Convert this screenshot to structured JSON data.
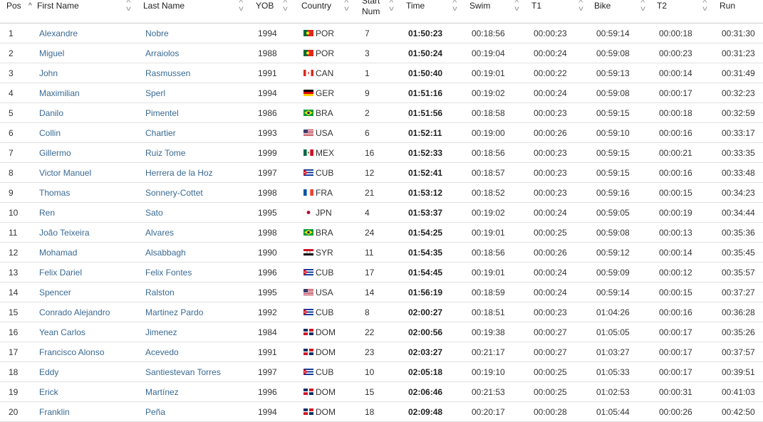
{
  "columns": {
    "pos": "Pos",
    "first_name": "First Name",
    "last_name": "Last Name",
    "yob": "YOB",
    "country": "Country",
    "start_num_1": "Start",
    "start_num_2": "Num",
    "time": "Time",
    "swim": "Swim",
    "t1": "T1",
    "bike": "Bike",
    "t2": "T2",
    "run": "Run"
  },
  "rows": [
    {
      "pos": "1",
      "first": "Alexandre",
      "last": "Nobre",
      "yob": "1994",
      "flag": "flag-portugal-icon",
      "country": "POR",
      "num": "7",
      "time": "01:50:23",
      "swim": "00:18:56",
      "t1": "00:00:23",
      "bike": "00:59:14",
      "t2": "00:00:18",
      "run": "00:31:30"
    },
    {
      "pos": "2",
      "first": "Miguel",
      "last": "Arraiolos",
      "yob": "1988",
      "flag": "flag-portugal-icon",
      "country": "POR",
      "num": "3",
      "time": "01:50:24",
      "swim": "00:19:04",
      "t1": "00:00:24",
      "bike": "00:59:08",
      "t2": "00:00:23",
      "run": "00:31:23"
    },
    {
      "pos": "3",
      "first": "John",
      "last": "Rasmussen",
      "yob": "1991",
      "flag": "flag-canada-icon",
      "country": "CAN",
      "num": "1",
      "time": "01:50:40",
      "swim": "00:19:01",
      "t1": "00:00:22",
      "bike": "00:59:13",
      "t2": "00:00:14",
      "run": "00:31:49"
    },
    {
      "pos": "4",
      "first": "Maximilian",
      "last": "Sperl",
      "yob": "1994",
      "flag": "flag-germany-icon",
      "country": "GER",
      "num": "9",
      "time": "01:51:16",
      "swim": "00:19:02",
      "t1": "00:00:24",
      "bike": "00:59:08",
      "t2": "00:00:17",
      "run": "00:32:23"
    },
    {
      "pos": "5",
      "first": "Danilo",
      "last": "Pimentel",
      "yob": "1986",
      "flag": "flag-brazil-icon",
      "country": "BRA",
      "num": "2",
      "time": "01:51:56",
      "swim": "00:18:58",
      "t1": "00:00:23",
      "bike": "00:59:15",
      "t2": "00:00:18",
      "run": "00:32:59"
    },
    {
      "pos": "6",
      "first": "Collin",
      "last": "Chartier",
      "yob": "1993",
      "flag": "flag-usa-icon",
      "country": "USA",
      "num": "6",
      "time": "01:52:11",
      "swim": "00:19:00",
      "t1": "00:00:26",
      "bike": "00:59:10",
      "t2": "00:00:16",
      "run": "00:33:17"
    },
    {
      "pos": "7",
      "first": "Gillermo",
      "last": "Ruiz Tome",
      "yob": "1999",
      "flag": "flag-mexico-icon",
      "country": "MEX",
      "num": "16",
      "time": "01:52:33",
      "swim": "00:18:56",
      "t1": "00:00:23",
      "bike": "00:59:15",
      "t2": "00:00:21",
      "run": "00:33:35"
    },
    {
      "pos": "8",
      "first": "Victor Manuel",
      "last": "Herrera de la Hoz",
      "yob": "1997",
      "flag": "flag-cuba-icon",
      "country": "CUB",
      "num": "12",
      "time": "01:52:41",
      "swim": "00:18:57",
      "t1": "00:00:23",
      "bike": "00:59:15",
      "t2": "00:00:16",
      "run": "00:33:48"
    },
    {
      "pos": "9",
      "first": "Thomas",
      "last": "Sonnery-Cottet",
      "yob": "1998",
      "flag": "flag-france-icon",
      "country": "FRA",
      "num": "21",
      "time": "01:53:12",
      "swim": "00:18:52",
      "t1": "00:00:23",
      "bike": "00:59:16",
      "t2": "00:00:15",
      "run": "00:34:23"
    },
    {
      "pos": "10",
      "first": "Ren",
      "last": "Sato",
      "yob": "1995",
      "flag": "flag-japan-icon",
      "country": "JPN",
      "num": "4",
      "time": "01:53:37",
      "swim": "00:19:02",
      "t1": "00:00:24",
      "bike": "00:59:05",
      "t2": "00:00:19",
      "run": "00:34:44"
    },
    {
      "pos": "11",
      "first": "João Teixeira",
      "last": "Alvares",
      "yob": "1998",
      "flag": "flag-brazil-icon",
      "country": "BRA",
      "num": "24",
      "time": "01:54:25",
      "swim": "00:19:01",
      "t1": "00:00:25",
      "bike": "00:59:08",
      "t2": "00:00:13",
      "run": "00:35:36"
    },
    {
      "pos": "12",
      "first": "Mohamad",
      "last": "Alsabbagh",
      "yob": "1990",
      "flag": "flag-syria-icon",
      "country": "SYR",
      "num": "11",
      "time": "01:54:35",
      "swim": "00:18:56",
      "t1": "00:00:26",
      "bike": "00:59:12",
      "t2": "00:00:14",
      "run": "00:35:45"
    },
    {
      "pos": "13",
      "first": "Felix Dariel",
      "last": "Felix Fontes",
      "yob": "1996",
      "flag": "flag-cuba-icon",
      "country": "CUB",
      "num": "17",
      "time": "01:54:45",
      "swim": "00:19:01",
      "t1": "00:00:24",
      "bike": "00:59:09",
      "t2": "00:00:12",
      "run": "00:35:57"
    },
    {
      "pos": "14",
      "first": "Spencer",
      "last": "Ralston",
      "yob": "1995",
      "flag": "flag-usa-icon",
      "country": "USA",
      "num": "14",
      "time": "01:56:19",
      "swim": "00:18:59",
      "t1": "00:00:24",
      "bike": "00:59:14",
      "t2": "00:00:15",
      "run": "00:37:27"
    },
    {
      "pos": "15",
      "first": "Conrado Alejandro",
      "last": "Martinez Pardo",
      "yob": "1992",
      "flag": "flag-cuba-icon",
      "country": "CUB",
      "num": "8",
      "time": "02:00:27",
      "swim": "00:18:51",
      "t1": "00:00:23",
      "bike": "01:04:26",
      "t2": "00:00:16",
      "run": "00:36:28"
    },
    {
      "pos": "16",
      "first": "Yean Carlos",
      "last": "Jimenez",
      "yob": "1984",
      "flag": "flag-dominican-republic-icon",
      "country": "DOM",
      "num": "22",
      "time": "02:00:56",
      "swim": "00:19:38",
      "t1": "00:00:27",
      "bike": "01:05:05",
      "t2": "00:00:17",
      "run": "00:35:26"
    },
    {
      "pos": "17",
      "first": "Francisco Alonso",
      "last": "Acevedo",
      "yob": "1991",
      "flag": "flag-dominican-republic-icon",
      "country": "DOM",
      "num": "23",
      "time": "02:03:27",
      "swim": "00:21:17",
      "t1": "00:00:27",
      "bike": "01:03:27",
      "t2": "00:00:17",
      "run": "00:37:57"
    },
    {
      "pos": "18",
      "first": "Eddy",
      "last": "Santiestevan Torres",
      "yob": "1997",
      "flag": "flag-cuba-icon",
      "country": "CUB",
      "num": "10",
      "time": "02:05:18",
      "swim": "00:19:10",
      "t1": "00:00:25",
      "bike": "01:05:33",
      "t2": "00:00:17",
      "run": "00:39:51"
    },
    {
      "pos": "19",
      "first": "Erick",
      "last": "Martínez",
      "yob": "1996",
      "flag": "flag-dominican-republic-icon",
      "country": "DOM",
      "num": "15",
      "time": "02:06:46",
      "swim": "00:21:53",
      "t1": "00:00:25",
      "bike": "01:02:53",
      "t2": "00:00:31",
      "run": "00:41:03"
    },
    {
      "pos": "20",
      "first": "Franklin",
      "last": "Peña",
      "yob": "1994",
      "flag": "flag-dominican-republic-icon",
      "country": "DOM",
      "num": "18",
      "time": "02:09:48",
      "swim": "00:20:17",
      "t1": "00:00:28",
      "bike": "01:05:44",
      "t2": "00:00:26",
      "run": "00:42:50"
    }
  ]
}
